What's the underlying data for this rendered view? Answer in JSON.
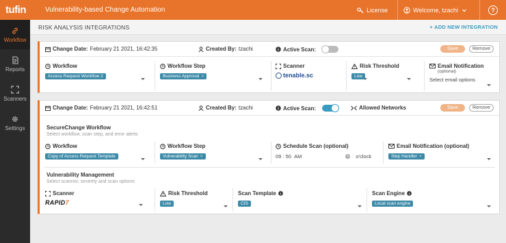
{
  "topbar": {
    "logo": "tufin",
    "title": "Vulnerability-based Change Automation",
    "license": "License",
    "welcome": "Welcome, tzachi",
    "help": "?"
  },
  "sidebar": {
    "items": [
      {
        "label": "Workflow",
        "icon": "link-icon",
        "active": true
      },
      {
        "label": "Reports",
        "icon": "report-icon",
        "active": false
      },
      {
        "label": "Scanners",
        "icon": "scanner-icon",
        "active": false
      },
      {
        "label": "Settings",
        "icon": "gear-icon",
        "active": false
      }
    ]
  },
  "header": {
    "title": "RISK ANALYSIS INTEGRATIONS",
    "add": "ADD NEW INTEGRATION"
  },
  "card1": {
    "change_date_label": "Change Date:",
    "change_date": "February 21 2021, 16:42:35",
    "created_by_label": "Created By:",
    "created_by": "tzachi",
    "active_scan_label": "Active Scan:",
    "active_scan": false,
    "save": "Save",
    "remove": "Remove",
    "workflow_label": "Workflow",
    "workflow_value": "Access Request Workflow 2",
    "step_label": "Workflow Step",
    "step_value": "Business Approval",
    "scanner_label": "Scanner",
    "scanner_value": "tenable.sc",
    "risk_label": "Risk Threshold",
    "risk_value": "Low",
    "email_label": "Email Notification",
    "email_sub": "(optional)",
    "email_value": "Select email options"
  },
  "card2": {
    "change_date_label": "Change Date:",
    "change_date": "February 21 2021, 16:42:51",
    "created_by_label": "Created By:",
    "created_by": "tzachi",
    "active_scan_label": "Active Scan:",
    "active_scan": true,
    "allowed_networks": "Allowed Networks",
    "save": "Save",
    "remove": "Remove",
    "sc_title": "SecureChange Workflow",
    "sc_desc": "Select workflow, scan step, and error alerts",
    "workflow_label": "Workflow",
    "workflow_value": "Copy of Access Request Template",
    "step_label": "Workflow Step",
    "step_value": "Vulnerability Scan",
    "schedule_label": "Schedule Scan (optional)",
    "schedule_hour": "09",
    "schedule_min": "50",
    "schedule_ampm": "AM",
    "schedule_suffix": "o'clock",
    "email_label": "Email Notification (optional)",
    "email_value": "Step Handler",
    "vm_title": "Vulnerability Management",
    "vm_desc": "Select scanner, severity and scan options",
    "scanner_label": "Scanner",
    "scanner_value_a": "RAPID",
    "scanner_value_b": "7",
    "risk_label": "Risk Threshold",
    "risk_value": "Low",
    "template_label": "Scan Template",
    "template_value": "CIS",
    "engine_label": "Scan Engine",
    "engine_value": "Local scan engine"
  },
  "colors": {
    "brand": "#e8732a",
    "accent": "#3a9bc1",
    "tag": "#3d8aa8"
  }
}
